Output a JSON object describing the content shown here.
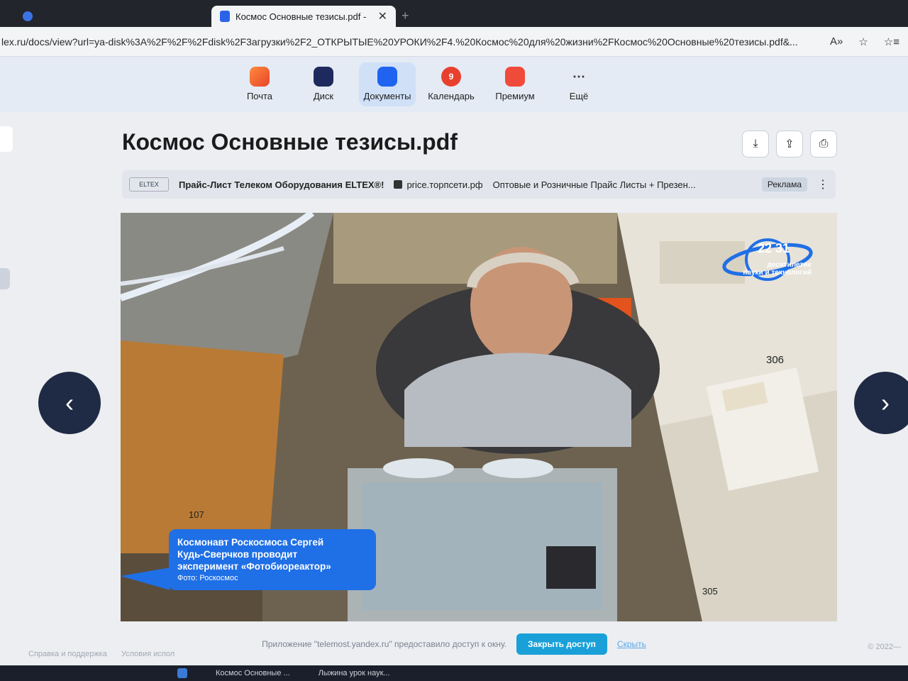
{
  "browser": {
    "tabs": [
      {
        "label": "",
        "active": false
      },
      {
        "label": "Космос Основные тезисы.pdf -",
        "active": true
      }
    ],
    "url": "lex.ru/docs/view?url=ya-disk%3A%2F%2F%2Fdisk%2F3агрузки%2F2_ОТКРЫТЫЕ%20УРОКИ%2F4.%20Космос%20для%20жизни%2FКосмос%20Основные%20тезисы.pdf&..."
  },
  "services": [
    {
      "label": "Почта",
      "icon": "mail-icon"
    },
    {
      "label": "Диск",
      "icon": "disk-icon"
    },
    {
      "label": "Документы",
      "icon": "documents-icon",
      "active": true
    },
    {
      "label": "Календарь",
      "icon": "calendar-icon",
      "badge": "9"
    },
    {
      "label": "Премиум",
      "icon": "premium-icon"
    },
    {
      "label": "Ещё",
      "icon": "more-icon"
    }
  ],
  "document": {
    "title": "Космос Основные тезисы.pdf"
  },
  "ad": {
    "logo": "ELTEX",
    "headline": "Прайс-Лист Телеком Оборудования ELTEX®!",
    "domain": "price.торпсети.рф",
    "description": "Оптовые и Розничные Прайс Листы + Презен...",
    "badge": "Реклама"
  },
  "slide": {
    "caption_lines": [
      "Космонавт Роскосмоса Сергей",
      "Кудь-Сверчков проводит",
      "эксперимент «Фотобиореактор»"
    ],
    "caption_credit": "Фото: Роскосмос",
    "logo_years": "22 31",
    "logo_text_1": "десятилетие",
    "logo_text_2": "науки и технологий",
    "panel_number_1": "306",
    "panel_number_2": "107",
    "panel_number_3": "305"
  },
  "share": {
    "message": "Приложение \"telemost.yandex.ru\" предоставило доступ к окну.",
    "button": "Закрыть доступ",
    "hide": "Скрыть"
  },
  "footer": {
    "left_1": "Справка и поддержка",
    "left_2": "Условия испол",
    "right": "© 2022—"
  },
  "taskbar": {
    "item_1": "Космос Основные ...",
    "item_2": "Лыжина урок наук..."
  }
}
